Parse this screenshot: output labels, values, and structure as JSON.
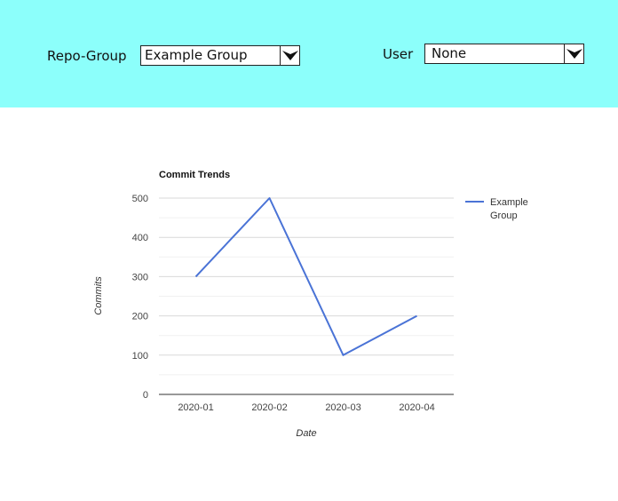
{
  "filters": {
    "repo_group": {
      "label": "Repo-Group",
      "selected": "Example Group",
      "arrow_icon": "chevron-down-icon"
    },
    "user": {
      "label": "User",
      "selected": "None",
      "arrow_icon": "chevron-down-icon"
    },
    "bar_color": "#8cfffb"
  },
  "chart_data": {
    "type": "line",
    "title": "Commit Trends",
    "xlabel": "Date",
    "ylabel": "Commits",
    "categories": [
      "2020-01",
      "2020-02",
      "2020-03",
      "2020-04"
    ],
    "series": [
      {
        "name": "Example Group",
        "values": [
          300,
          500,
          100,
          200
        ],
        "color": "#4a73d6"
      }
    ],
    "ylim": [
      0,
      500
    ],
    "yticks": [
      0,
      100,
      200,
      300,
      400,
      500
    ],
    "grid": true,
    "legend": "right"
  }
}
